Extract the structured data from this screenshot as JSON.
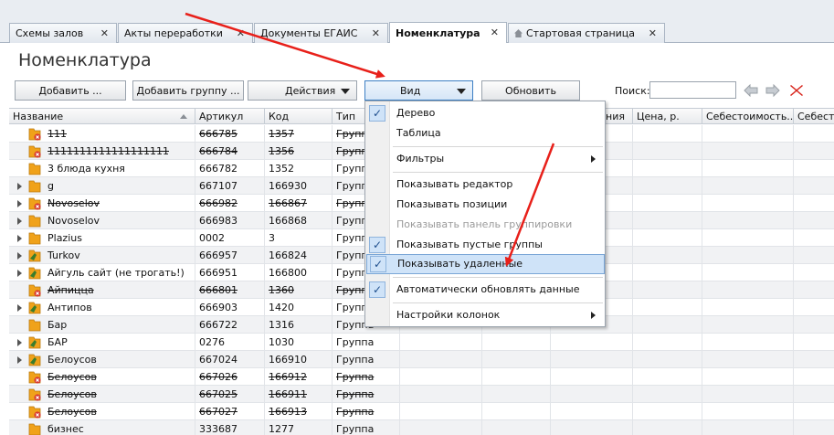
{
  "tabs": [
    {
      "label": "Схемы залов",
      "close": "✕"
    },
    {
      "label": "Акты переработки",
      "close": "✕"
    },
    {
      "label": "Документы ЕГАИС",
      "close": "✕"
    },
    {
      "label": "Номенклатура",
      "close": "✕"
    },
    {
      "label": "Стартовая страница",
      "close": "✕"
    }
  ],
  "page_title": "Номенклатура",
  "toolbar": {
    "add": "Добавить ...",
    "add_group": "Добавить группу ...",
    "actions": "Действия",
    "view": "Вид",
    "refresh": "Обновить",
    "search_label": "Поиск:",
    "search_value": ""
  },
  "columns": [
    "Название",
    "Артикул",
    "Код",
    "Тип",
    "",
    "",
    "ния",
    "Цена, р.",
    "Себестоимость...",
    "Себест"
  ],
  "rows": [
    {
      "name": "111",
      "article": "666785",
      "code": "1357",
      "type": "Группа",
      "deleted": true
    },
    {
      "name": "1111111111111111111",
      "article": "666784",
      "code": "1356",
      "type": "Группа",
      "deleted": true
    },
    {
      "name": "3 блюда кухня",
      "article": "666782",
      "code": "1352",
      "type": "Группа",
      "deleted": false
    },
    {
      "name": "g",
      "article": "667107",
      "code": "166930",
      "type": "Группа",
      "deleted": false
    },
    {
      "name": "Novoselov",
      "article": "666982",
      "code": "166867",
      "type": "Группа",
      "deleted": true
    },
    {
      "name": "Novoselov",
      "article": "666983",
      "code": "166868",
      "type": "Группа",
      "deleted": false
    },
    {
      "name": "Plazius",
      "article": "0002",
      "code": "3",
      "type": "Группа",
      "deleted": false
    },
    {
      "name": "Turkov",
      "article": "666957",
      "code": "166824",
      "type": "Группа",
      "deleted": false
    },
    {
      "name": "Айгуль сайт (не трогать!)",
      "article": "666951",
      "code": "166800",
      "type": "Группа",
      "deleted": false
    },
    {
      "name": "Айпицца",
      "article": "666801",
      "code": "1360",
      "type": "Группа",
      "deleted": true
    },
    {
      "name": "Антипов",
      "article": "666903",
      "code": "1420",
      "type": "Группа",
      "deleted": false
    },
    {
      "name": "Бар",
      "article": "666722",
      "code": "1316",
      "type": "Группа",
      "deleted": false
    },
    {
      "name": "БАР",
      "article": "0276",
      "code": "1030",
      "type": "Группа",
      "deleted": false
    },
    {
      "name": "Белоусов",
      "article": "667024",
      "code": "166910",
      "type": "Группа",
      "deleted": false
    },
    {
      "name": "Белоусов",
      "article": "667026",
      "code": "166912",
      "type": "Группа",
      "deleted": true
    },
    {
      "name": "Белоусов",
      "article": "667025",
      "code": "166911",
      "type": "Группа",
      "deleted": true
    },
    {
      "name": "Белоусов",
      "article": "667027",
      "code": "166913",
      "type": "Группа",
      "deleted": true
    },
    {
      "name": "бизнес",
      "article": "333687",
      "code": "1277",
      "type": "Группа",
      "deleted": false
    }
  ],
  "menu": {
    "items": [
      {
        "label": "Дерево",
        "checked": true
      },
      {
        "label": "Таблица",
        "checked": false
      },
      {
        "label": "Фильтры",
        "checked": false
      },
      {
        "label": "Показывать редактор",
        "checked": false
      },
      {
        "label": "Показывать позиции",
        "checked": false
      },
      {
        "label": "Показывать панель группировки",
        "checked": false
      },
      {
        "label": "Показывать пустые группы",
        "checked": true
      },
      {
        "label": "Показывать удаленные",
        "checked": true
      },
      {
        "label": "Автоматически обновлять данные",
        "checked": true
      },
      {
        "label": "Настройки колонок",
        "checked": false
      }
    ]
  },
  "colors": {
    "accent": "#3d7fc4",
    "highlight": "#cfe3f8",
    "annotation_arrow": "#e8201a",
    "folder": "#f0a21a",
    "deleted_badge": "#d83a2f"
  }
}
